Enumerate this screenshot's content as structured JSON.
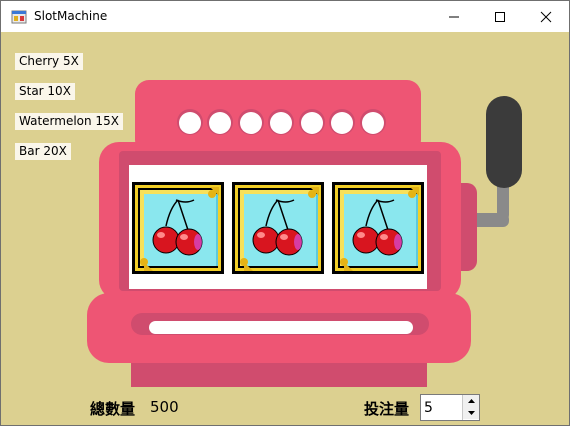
{
  "window": {
    "title": "SlotMachine"
  },
  "paytable": [
    {
      "label": "Cherry 5X"
    },
    {
      "label": "Star 10X"
    },
    {
      "label": "Watermelon 15X"
    },
    {
      "label": "Bar 20X"
    }
  ],
  "reels": [
    {
      "symbol": "cherry-icon"
    },
    {
      "symbol": "cherry-icon"
    },
    {
      "symbol": "cherry-icon"
    }
  ],
  "bottom": {
    "total_label": "總數量",
    "total_value": "500",
    "bet_label": "投注量",
    "bet_value": "5"
  },
  "colors": {
    "background": "#dcd090",
    "machine_body": "#ee5574",
    "machine_shadow": "#d04c6e",
    "handle": "#3b3b3b"
  }
}
